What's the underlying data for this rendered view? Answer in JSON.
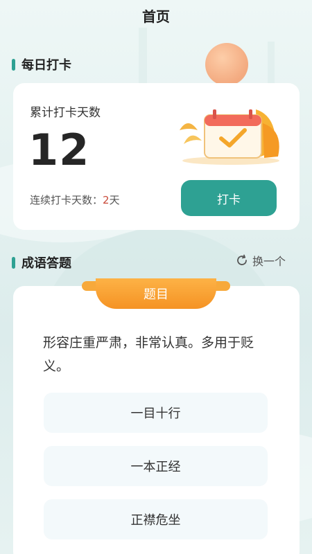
{
  "header": {
    "title": "首页"
  },
  "checkin": {
    "section_title": "每日打卡",
    "total_label": "累计打卡天数",
    "total_value": "12",
    "streak_label": "连续打卡天数：",
    "streak_value": "2",
    "streak_unit": "天",
    "button_label": "打卡"
  },
  "quiz": {
    "section_title": "成语答题",
    "switch_label": "换一个",
    "ribbon_label": "题目",
    "question": "形容庄重严肃，非常认真。多用于贬义。",
    "options": [
      "一目十行",
      "一本正经",
      "正襟危坐"
    ]
  },
  "colors": {
    "accent": "#2ea193",
    "ribbon": "#f59324",
    "highlight": "#c94a3a"
  }
}
